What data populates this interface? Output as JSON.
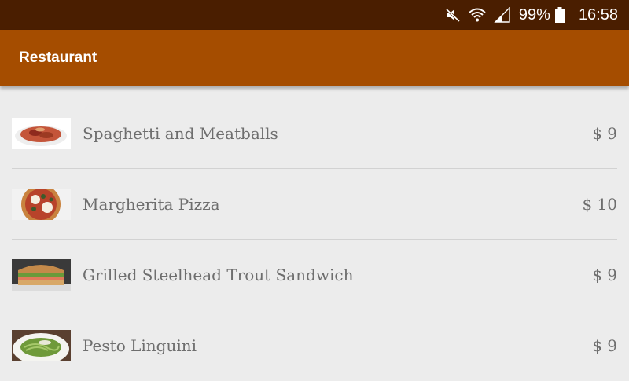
{
  "status_bar": {
    "icons": [
      "mute-icon",
      "wifi-icon",
      "signal-icon",
      "battery-icon"
    ],
    "battery_percent": "99%",
    "time": "16:58"
  },
  "app_bar": {
    "title": "Restaurant",
    "color": "#a54d00"
  },
  "menu": {
    "items": [
      {
        "name": "Spaghetti and Meatballs",
        "price": "$ 9",
        "image": "spaghetti-photo"
      },
      {
        "name": "Margherita Pizza",
        "price": "$ 10",
        "image": "pizza-photo"
      },
      {
        "name": "Grilled Steelhead Trout Sandwich",
        "price": "$ 9",
        "image": "sandwich-photo"
      },
      {
        "name": "Pesto Linguini",
        "price": "$ 9",
        "image": "pesto-photo"
      }
    ]
  },
  "colors": {
    "status_bar": "#4a1e00",
    "app_bar": "#a54d00",
    "background": "#ececec",
    "text": "#6e6e6e"
  }
}
